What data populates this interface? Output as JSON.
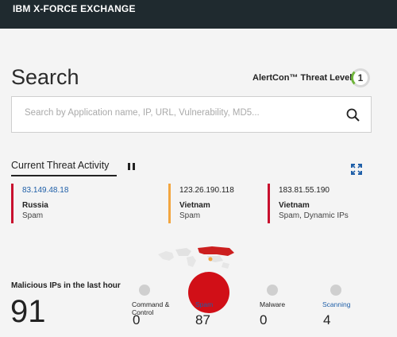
{
  "header": {
    "brand": "IBM X-FORCE EXCHANGE"
  },
  "search": {
    "title": "Search",
    "placeholder": "Search by Application name, IP, URL, Vulnerability, MD5..."
  },
  "alertcon": {
    "label": "AlertCon™ Threat Level",
    "level": "1"
  },
  "activity": {
    "tab_label": "Current Threat Activity",
    "cards": [
      {
        "ip": "83.149.48.18",
        "country": "Russia",
        "category": "Spam",
        "color": "#c8102e"
      },
      {
        "ip": "123.26.190.118",
        "country": "Vietnam",
        "category": "Spam",
        "color": "#f2a640"
      },
      {
        "ip": "183.81.55.190",
        "country": "Vietnam",
        "category": "Spam, Dynamic IPs",
        "color": "#c8102e"
      }
    ]
  },
  "stats": {
    "label": "Malicious IPs in the last hour",
    "total": "91",
    "categories": [
      {
        "label": "Command & Control",
        "value": "0"
      },
      {
        "label": "Spam",
        "value": "87"
      },
      {
        "label": "Malware",
        "value": "0"
      },
      {
        "label": "Scanning",
        "value": "4"
      }
    ]
  },
  "colors": {
    "header_bg": "#1f2a2f",
    "accent_red": "#c8102e",
    "accent_orange": "#f2a640",
    "link_blue": "#1f5fa8"
  }
}
